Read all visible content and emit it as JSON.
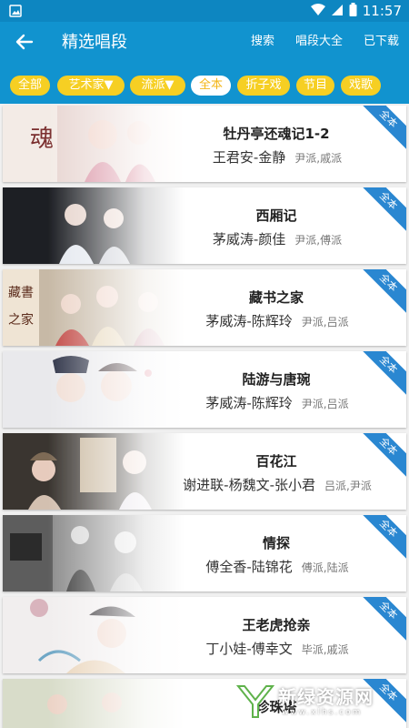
{
  "status_bar": {
    "time": "11:57"
  },
  "app_bar": {
    "title": "精选唱段",
    "actions": [
      "搜索",
      "唱段大全",
      "已下载"
    ]
  },
  "filters": [
    {
      "label": "全部",
      "active": false
    },
    {
      "label": "艺术家▼",
      "active": false
    },
    {
      "label": "流派▼",
      "active": false
    },
    {
      "label": "全本",
      "active": true
    },
    {
      "label": "折子戏",
      "active": false
    },
    {
      "label": "节目",
      "active": false
    },
    {
      "label": "戏歌",
      "active": false
    }
  ],
  "items": [
    {
      "title": "牡丹亭还魂记1-2",
      "performers": "王君安-金静",
      "school": "尹派,戚派",
      "badge": "全本"
    },
    {
      "title": "西厢记",
      "performers": "茅威涛-颜佳",
      "school": "尹派,傅派",
      "badge": "全本"
    },
    {
      "title": "藏书之家",
      "performers": "茅威涛-陈辉玲",
      "school": "尹派,吕派",
      "badge": "全本"
    },
    {
      "title": "陆游与唐琬",
      "performers": "茅威涛-陈辉玲",
      "school": "尹派,吕派",
      "badge": "全本"
    },
    {
      "title": "百花江",
      "performers": "谢进联-杨魏文-张小君",
      "school": "吕派,尹派",
      "badge": "全本"
    },
    {
      "title": "情探",
      "performers": "傅全香-陆锦花",
      "school": "傅派,陆派",
      "badge": "全本"
    },
    {
      "title": "王老虎抢亲",
      "performers": "丁小娃-傅幸文",
      "school": "毕派,戚派",
      "badge": "全本"
    },
    {
      "title": "珍珠塔",
      "performers": "",
      "school": "",
      "badge": "全本"
    }
  ],
  "watermark": {
    "text": "新绿资源网",
    "url": "www.xlhs.com"
  },
  "colors": {
    "primary": "#1193cf",
    "status_bar": "#0d86c1",
    "chip": "#f6cf23",
    "chip_active_text": "#f3b617",
    "ribbon": "#2a87d1"
  }
}
